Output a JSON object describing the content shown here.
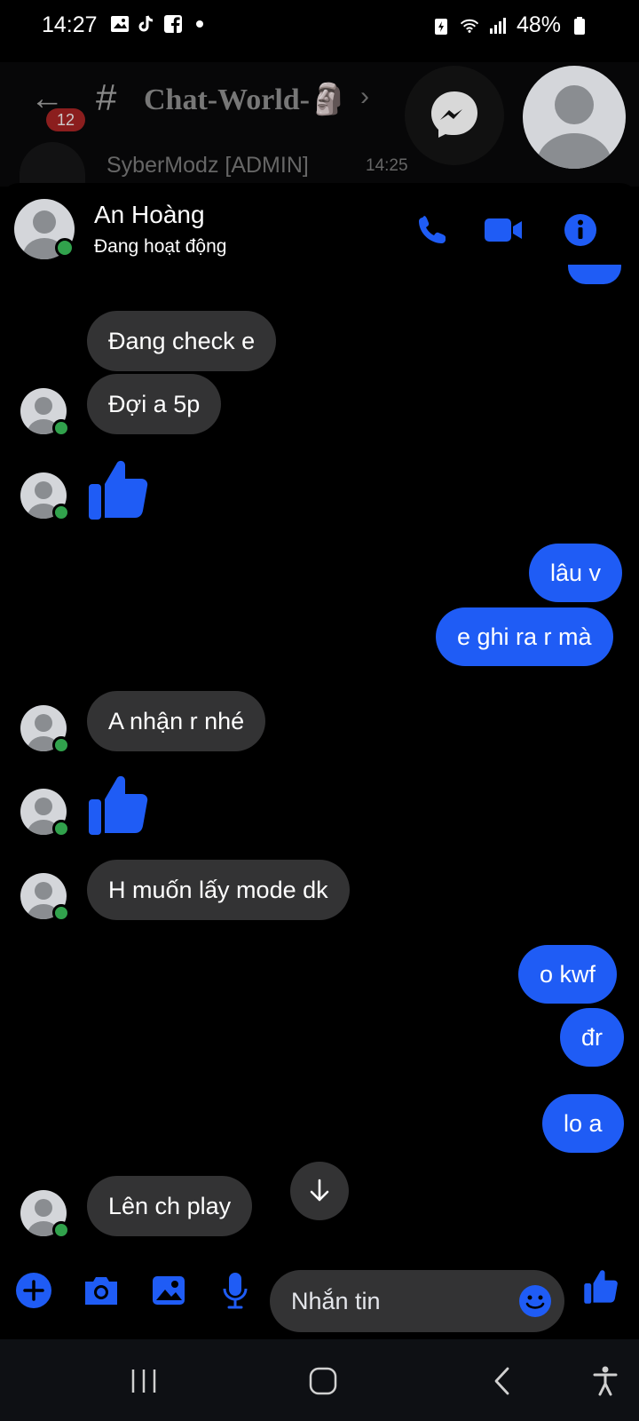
{
  "status_bar": {
    "time": "14:27",
    "battery_percent": "48%",
    "icons": [
      "image-icon",
      "tiktok-icon",
      "facebook-icon",
      "dot-icon",
      "battery-saver-icon",
      "wifi-icon",
      "signal-icon",
      "battery-icon"
    ]
  },
  "background_app": {
    "channel_name": "Chat-World-🗿",
    "hash": "#",
    "unread_badge": "12",
    "user_name": "SyberModz [ADMIN]",
    "message_time": "14:25"
  },
  "chat_header": {
    "name": "An Hoàng",
    "status": "Đang hoạt động"
  },
  "messages": [
    {
      "side": "in",
      "text": "Đang check e"
    },
    {
      "side": "in",
      "text": "Đợi a 5p"
    },
    {
      "side": "in",
      "type": "like"
    },
    {
      "side": "out",
      "text": "lâu v"
    },
    {
      "side": "out",
      "text": "e ghi ra r mà"
    },
    {
      "side": "in",
      "text": "A nhận r nhé"
    },
    {
      "side": "in",
      "type": "like"
    },
    {
      "side": "in",
      "text": "H muốn lấy mode dk"
    },
    {
      "side": "out",
      "text": "o kwf"
    },
    {
      "side": "out",
      "text": "đr"
    },
    {
      "side": "out",
      "text": "lo a"
    },
    {
      "side": "in",
      "text": "Lên ch play"
    }
  ],
  "composer": {
    "placeholder": "Nhắn tin"
  },
  "colors": {
    "accent": "#1f5cf5",
    "incoming_bubble": "#333334",
    "online": "#31a24c",
    "background": "#000000"
  }
}
